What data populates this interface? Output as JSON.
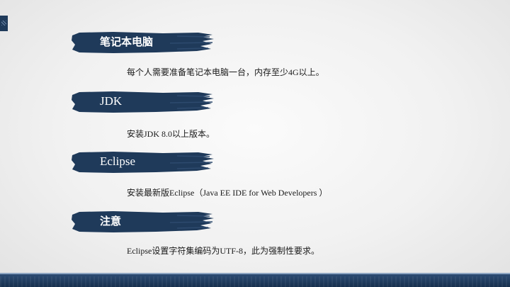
{
  "colors": {
    "banner": "#1f3a5a",
    "banner_text": "#ffffff",
    "body_text": "#1a1a1a",
    "footer": "#1f3a5a"
  },
  "sections": [
    {
      "title": "笔记本电脑",
      "text": "每个人需要准备笔记本电脑一台，内存至少4G以上。"
    },
    {
      "title": "JDK",
      "text": "安装JDK 8.0以上版本。"
    },
    {
      "title": "Eclipse",
      "text": "安装最新版Eclipse（Java EE IDE for Web Developers ）"
    },
    {
      "title": "注意",
      "text": "Eclipse设置字符集编码为UTF-8，此为强制性要求。"
    }
  ]
}
